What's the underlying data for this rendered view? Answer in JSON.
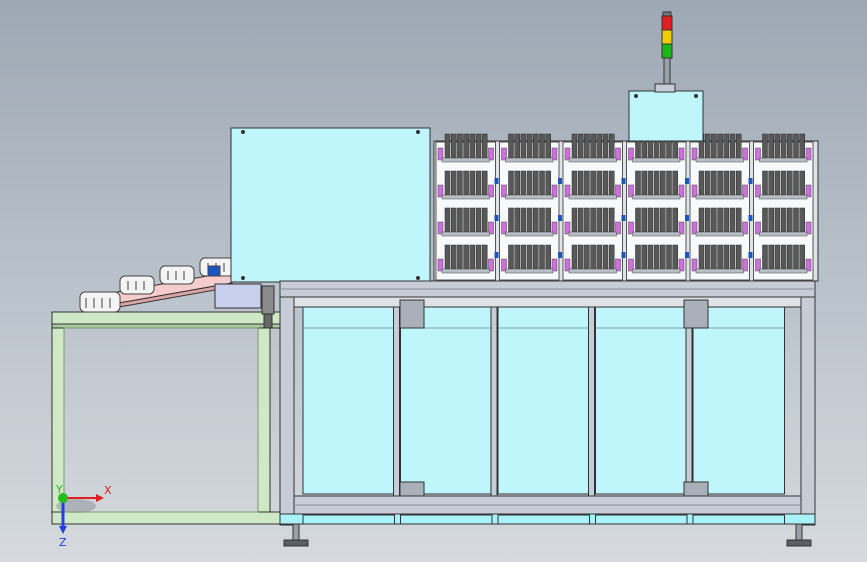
{
  "cad_view": {
    "triad": {
      "x_label": "X",
      "y_label": "Y",
      "z_label": "Z",
      "colors": {
        "x": "#e02020",
        "y": "#20c020",
        "z": "#2040e0"
      }
    },
    "colors": {
      "background_top": "#9ea8b4",
      "background_bottom": "#d6dade",
      "enclosure_panel": "#bff6fb",
      "frame_cyan": "#a8f2f8",
      "aluminum_profile": "#c7ccd6",
      "conveyor_frame": "#cfe8c6",
      "inclined_tray": "#f6cccc",
      "product_white": "#f4f4f4",
      "magazine_dark": "#585858",
      "accent_magenta": "#d070e0",
      "accent_blue": "#1a55c0",
      "signal_red": "#e41c1c",
      "signal_yellow": "#f0cc00",
      "signal_green": "#18b818"
    },
    "rack": {
      "columns": 6,
      "rows": 4
    },
    "signal_tower": {
      "segments": [
        "red",
        "yellow",
        "green"
      ]
    }
  }
}
